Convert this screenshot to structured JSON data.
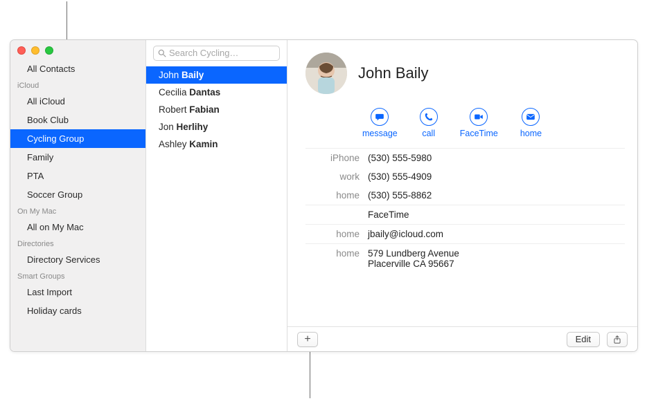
{
  "window": {
    "traffic": {
      "close": "close",
      "minimize": "minimize",
      "zoom": "zoom"
    }
  },
  "sidebar": {
    "top_item": "All Contacts",
    "sections": [
      {
        "header": "iCloud",
        "items": [
          {
            "label": "All iCloud",
            "selected": false
          },
          {
            "label": "Book Club",
            "selected": false
          },
          {
            "label": "Cycling Group",
            "selected": true
          },
          {
            "label": "Family",
            "selected": false
          },
          {
            "label": "PTA",
            "selected": false
          },
          {
            "label": "Soccer Group",
            "selected": false
          }
        ]
      },
      {
        "header": "On My Mac",
        "items": [
          {
            "label": "All on My Mac",
            "selected": false
          }
        ]
      },
      {
        "header": "Directories",
        "items": [
          {
            "label": "Directory Services",
            "selected": false
          }
        ]
      },
      {
        "header": "Smart Groups",
        "items": [
          {
            "label": "Last Import",
            "selected": false
          },
          {
            "label": "Holiday cards",
            "selected": false
          }
        ]
      }
    ]
  },
  "search": {
    "placeholder": "Search Cycling…",
    "value": ""
  },
  "contact_list": [
    {
      "first": "John",
      "last": "Baily",
      "selected": true
    },
    {
      "first": "Cecilia",
      "last": "Dantas",
      "selected": false
    },
    {
      "first": "Robert",
      "last": "Fabian",
      "selected": false
    },
    {
      "first": "Jon",
      "last": "Herlihy",
      "selected": false
    },
    {
      "first": "Ashley",
      "last": "Kamin",
      "selected": false
    }
  ],
  "card": {
    "name": "John Baily",
    "actions": {
      "message": "message",
      "call": "call",
      "facetime": "FaceTime",
      "home": "home"
    },
    "phones": [
      {
        "label": "iPhone",
        "value": "(530) 555-5980"
      },
      {
        "label": "work",
        "value": "(530) 555-4909"
      },
      {
        "label": "home",
        "value": "(530) 555-8862"
      }
    ],
    "facetime_header": "FaceTime",
    "emails": [
      {
        "label": "home",
        "value": "jbaily@icloud.com"
      }
    ],
    "addresses": [
      {
        "label": "home",
        "line1": "579 Lundberg Avenue",
        "line2": "Placerville CA 95667"
      }
    ]
  },
  "buttons": {
    "add": "+",
    "edit": "Edit",
    "share": "share"
  },
  "colors": {
    "accent": "#0a66ff",
    "sidebar_bg": "#f1f0f0",
    "muted": "#8a8a8a"
  }
}
